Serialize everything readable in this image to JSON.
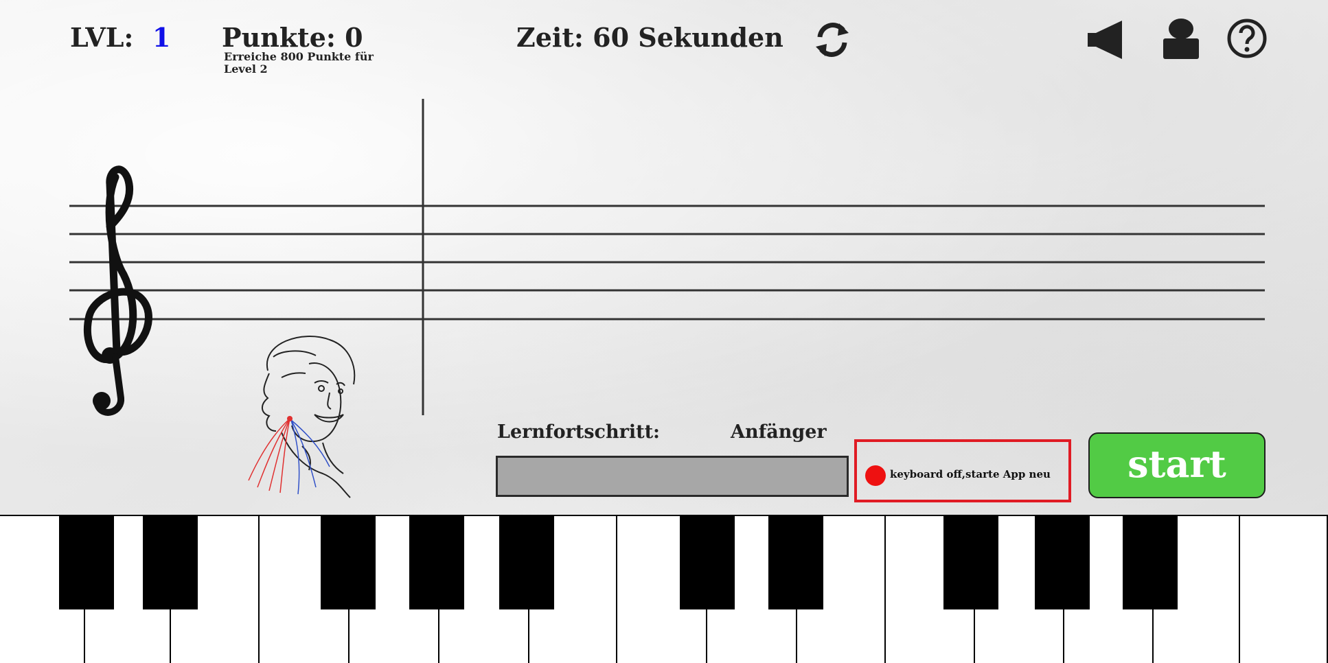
{
  "hud": {
    "lvl_label": "LVL:",
    "lvl_value": "1",
    "points": "Punkte: 0",
    "goal": "Erreiche 800 Punkte für Level 2",
    "time": "Zeit: 60 Sekunden"
  },
  "icons": {
    "refresh": "refresh-icon",
    "sound": "speaker-icon",
    "profile": "profile-icon",
    "help": "help-icon"
  },
  "staff": {
    "clef": "treble-clef"
  },
  "progress": {
    "label": "Lernfortschritt:",
    "level_name": "Anfänger",
    "fraction": 0
  },
  "status": {
    "text": "keyboard off,starte App neu",
    "indicator_color": "#ee1111"
  },
  "start_button": {
    "label": "start",
    "color": "#52cb45"
  },
  "colors": {
    "level_value": "#1010e8",
    "status_border": "#e01b24"
  }
}
